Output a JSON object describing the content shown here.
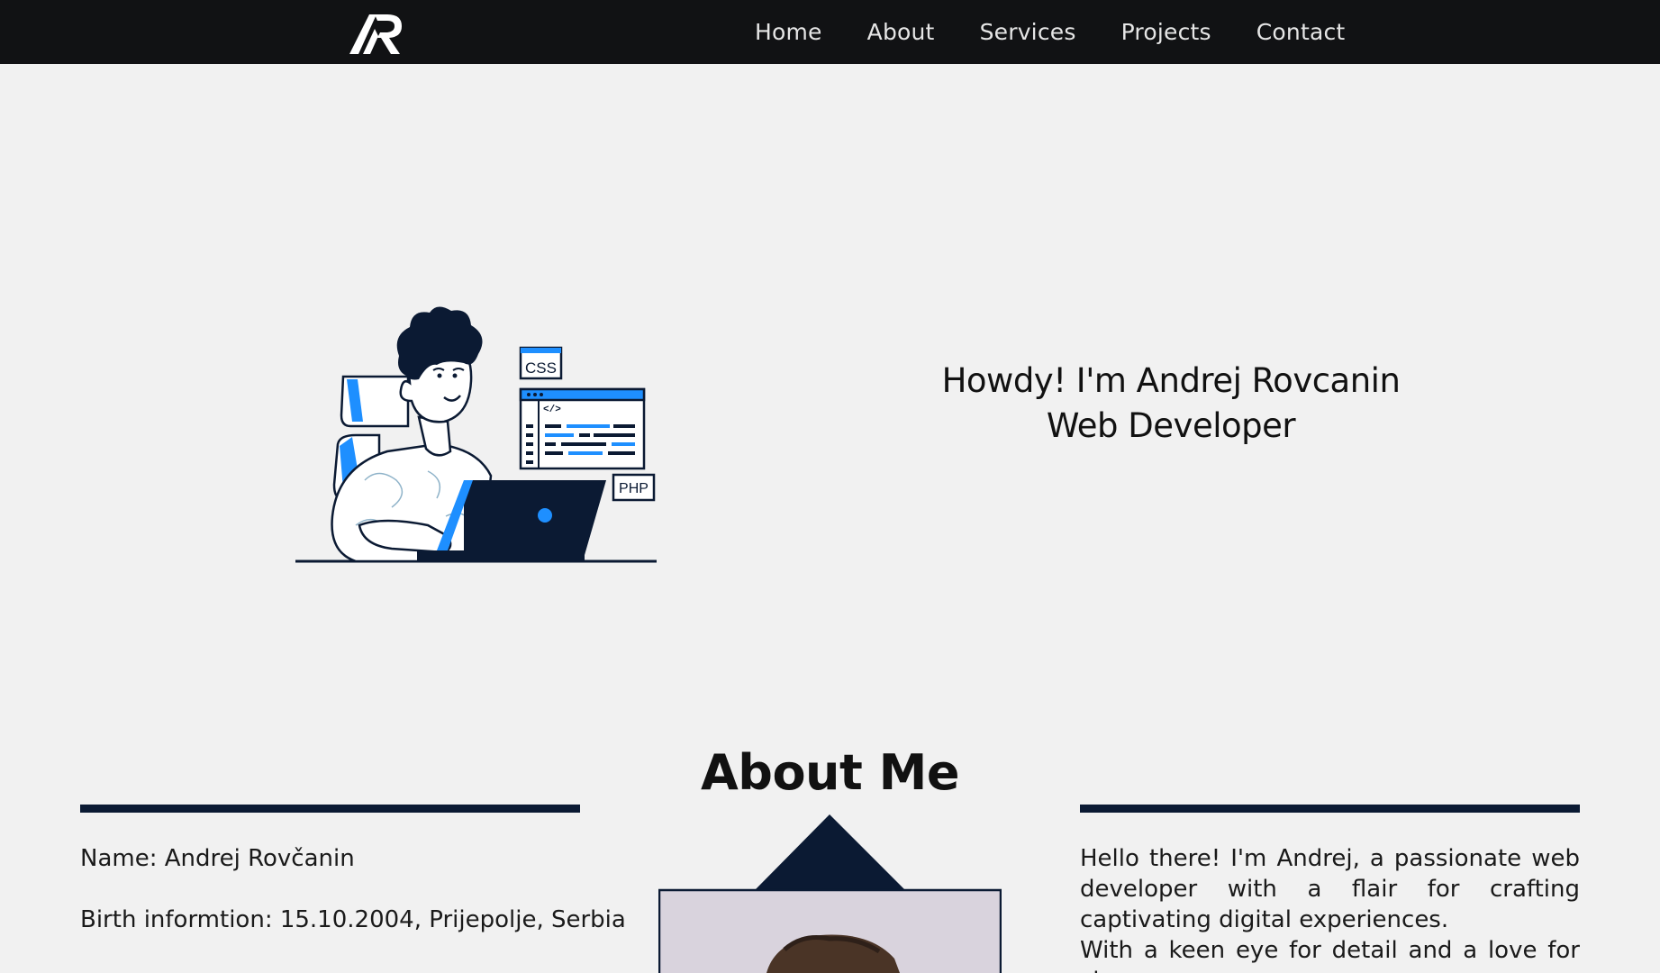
{
  "nav": {
    "logo_alt": "AR",
    "links": [
      "Home",
      "About",
      "Services",
      "Projects",
      "Contact"
    ]
  },
  "hero": {
    "greeting": "Howdy! I'm Andrej Rovcanin",
    "role": "Web Developer",
    "illustration": {
      "css_tag": "CSS",
      "php_tag": "PHP",
      "code_tag": "</>"
    }
  },
  "about": {
    "title": "About Me",
    "name_line": "Name: Andrej Rovčanin",
    "birth_line": "Birth informtion: 15.10.2004, Prijepolje, Serbia",
    "bio_p1": "Hello there! I'm Andrej, a passionate web developer with a flair for crafting captivating digital experiences.",
    "bio_p2": "With a keen eye for detail and a love for clean,"
  },
  "colors": {
    "navbar": "#111214",
    "background": "#f1f1f1",
    "accent_blue": "#1e8fff",
    "navy": "#0b1a33"
  }
}
